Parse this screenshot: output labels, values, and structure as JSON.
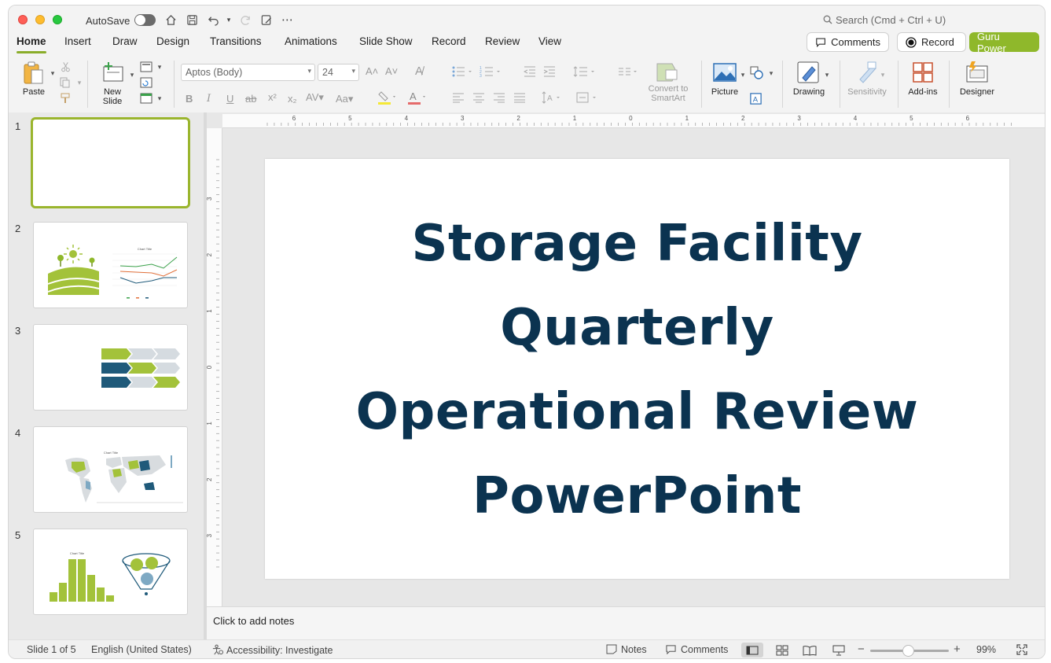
{
  "titlebar": {
    "autosave_label": "AutoSave",
    "search_placeholder": "Search (Cmd + Ctrl + U)"
  },
  "tabs": [
    {
      "label": "Home",
      "active": true
    },
    {
      "label": "Insert"
    },
    {
      "label": "Draw"
    },
    {
      "label": "Design"
    },
    {
      "label": "Transitions"
    },
    {
      "label": "Animations"
    },
    {
      "label": "Slide Show"
    },
    {
      "label": "Record"
    },
    {
      "label": "Review"
    },
    {
      "label": "View"
    }
  ],
  "header_buttons": {
    "comments": "Comments",
    "record": "Record",
    "guru": "Guru Power"
  },
  "ribbon": {
    "paste": "Paste",
    "new_slide_line1": "New",
    "new_slide_line2": "Slide",
    "font_name": "Aptos (Body)",
    "font_size": "24",
    "convert_line1": "Convert to",
    "convert_line2": "SmartArt",
    "picture": "Picture",
    "drawing": "Drawing",
    "sensitivity": "Sensitivity",
    "addins": "Add-ins",
    "designer": "Designer"
  },
  "slides": [
    {
      "number": "1",
      "selected": true
    },
    {
      "number": "2"
    },
    {
      "number": "3"
    },
    {
      "number": "4"
    },
    {
      "number": "5"
    }
  ],
  "thumb_text": {
    "chart_title": "Chart Title"
  },
  "slide_title": {
    "line1": "Storage Facility",
    "line2": "Quarterly",
    "line3": "Operational Review",
    "line4": "PowerPoint"
  },
  "ruler": {
    "h_labels": [
      "6",
      "5",
      "4",
      "3",
      "2",
      "1",
      "0",
      "1",
      "2",
      "3",
      "4",
      "5",
      "6"
    ],
    "v_labels": [
      "3",
      "2",
      "1",
      "0",
      "1",
      "2",
      "3"
    ]
  },
  "notes_placeholder": "Click to add notes",
  "statusbar": {
    "slide_count": "Slide 1 of 5",
    "language": "English (United States)",
    "accessibility": "Accessibility: Investigate",
    "notes": "Notes",
    "comments": "Comments",
    "zoom": "99%"
  },
  "colors": {
    "accent_green": "#8fb82b",
    "title_navy": "#0b3350",
    "thumb_green": "#a3c23a",
    "thumb_blue": "#1f5a7a"
  }
}
